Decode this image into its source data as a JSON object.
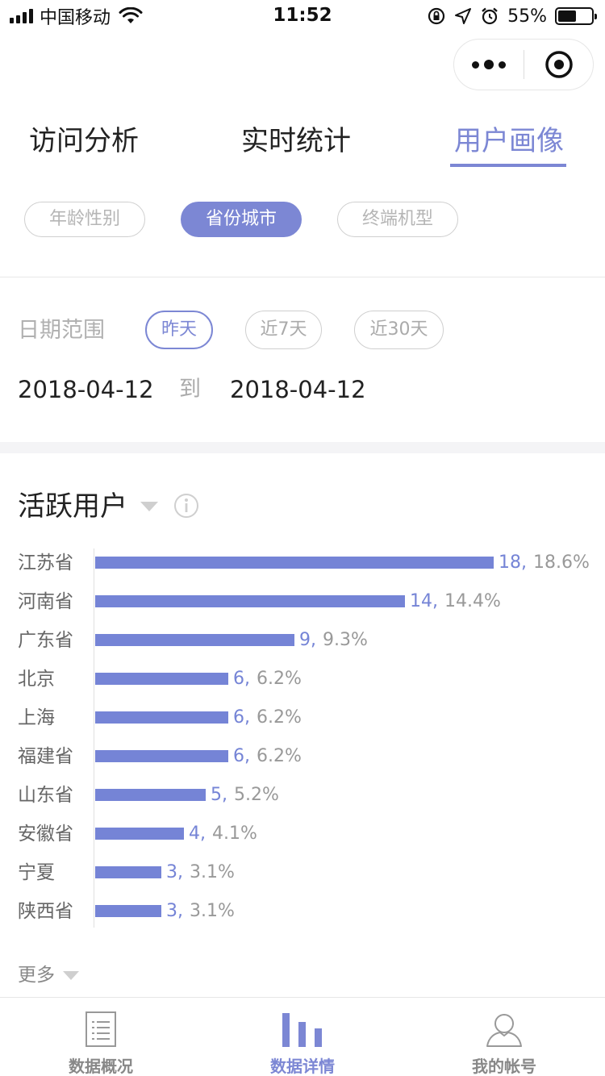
{
  "status_bar": {
    "carrier": "中国移动",
    "time": "11:52",
    "battery": "55%",
    "battery_level": 0.55
  },
  "tabs": [
    {
      "label": "访问分析",
      "active": false
    },
    {
      "label": "实时统计",
      "active": false
    },
    {
      "label": "用户画像",
      "active": true
    }
  ],
  "sub_tabs": [
    {
      "label": "年龄性别",
      "active": false
    },
    {
      "label": "省份城市",
      "active": true
    },
    {
      "label": "终端机型",
      "active": false
    }
  ],
  "date_range": {
    "label": "日期范围",
    "options": [
      {
        "label": "昨天",
        "active": true
      },
      {
        "label": "近7天",
        "active": false
      },
      {
        "label": "近30天",
        "active": false
      }
    ],
    "start": "2018-04-12",
    "to": "到",
    "end": "2018-04-12"
  },
  "section": {
    "title": "活跃用户",
    "more": "更多"
  },
  "chart_data": {
    "type": "bar",
    "orientation": "horizontal",
    "categories": [
      "江苏省",
      "河南省",
      "广东省",
      "北京",
      "上海",
      "福建省",
      "山东省",
      "安徽省",
      "宁夏",
      "陕西省"
    ],
    "values": [
      18,
      14,
      9,
      6,
      6,
      6,
      5,
      4,
      3,
      3
    ],
    "percent_labels": [
      "18.6%",
      "14.4%",
      "9.3%",
      "6.2%",
      "6.2%",
      "6.2%",
      "5.2%",
      "4.1%",
      "3.1%",
      "3.1%"
    ],
    "bar_color": "#7584d6"
  },
  "bottom_nav": [
    {
      "label": "数据概况",
      "icon": "document-list-icon",
      "active": false
    },
    {
      "label": "数据详情",
      "icon": "bar-chart-icon",
      "active": true
    },
    {
      "label": "我的帐号",
      "icon": "user-icon",
      "active": false
    }
  ],
  "colors": {
    "accent": "#7c87d4",
    "bar": "#7584d6"
  }
}
